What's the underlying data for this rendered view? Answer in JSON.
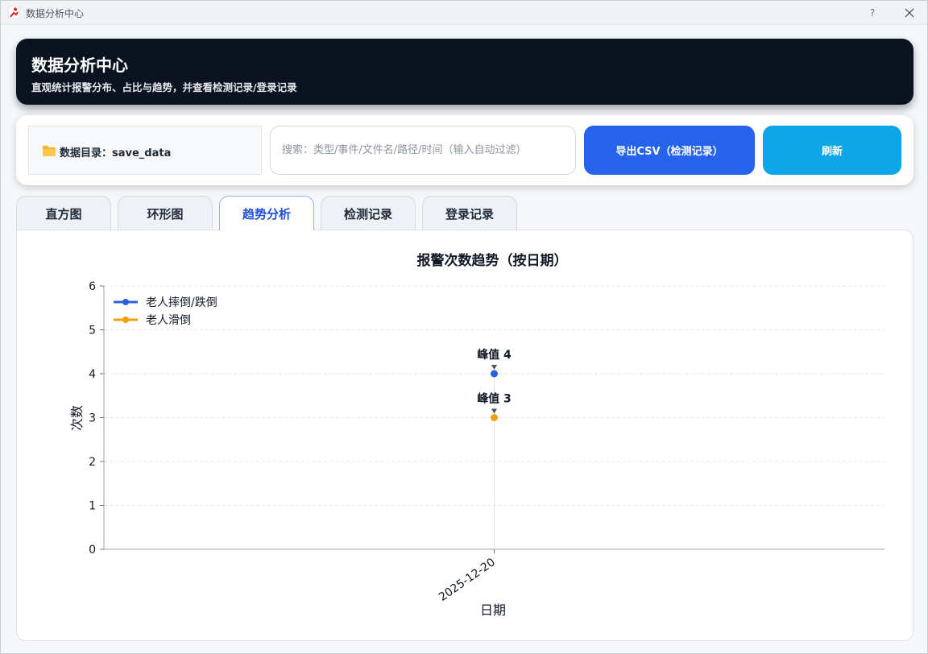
{
  "window": {
    "title": "数据分析中心",
    "help": "?"
  },
  "header": {
    "title": "数据分析中心",
    "subtitle": "直观统计报警分布、占比与趋势，并查看检测记录/登录记录"
  },
  "toolbar": {
    "dir_label": "数据目录：save_data",
    "search_placeholder": "搜索：类型/事件/文件名/路径/时间（输入自动过滤）",
    "export_label": "导出CSV（检测记录）",
    "refresh_label": "刷新"
  },
  "tabs": [
    {
      "label": "直方图",
      "active": false
    },
    {
      "label": "环形图",
      "active": false
    },
    {
      "label": "趋势分析",
      "active": true
    },
    {
      "label": "检测记录",
      "active": false
    },
    {
      "label": "登录记录",
      "active": false
    }
  ],
  "colors": {
    "accent": "#2563eb",
    "refresh": "#0ea5e9",
    "header_bg": "#0b1220",
    "series_blue": "#2b5fd9",
    "series_orange": "#f59e0b"
  },
  "chart_data": {
    "type": "line",
    "title": "报警次数趋势（按日期）",
    "xlabel": "日期",
    "ylabel": "次数",
    "x": [
      "2025-12-20"
    ],
    "ylim": [
      0,
      6
    ],
    "yticks": [
      0,
      1,
      2,
      3,
      4,
      5,
      6
    ],
    "grid": true,
    "legend_position": "top-left",
    "series": [
      {
        "name": "老人摔倒/跌倒",
        "values": [
          4
        ],
        "color": "#2b5fd9"
      },
      {
        "name": "老人滑倒",
        "values": [
          3
        ],
        "color": "#f59e0b"
      }
    ],
    "annotations": [
      {
        "text": "峰值 4",
        "x": "2025-12-20",
        "y": 4
      },
      {
        "text": "峰值 3",
        "x": "2025-12-20",
        "y": 3
      }
    ]
  }
}
